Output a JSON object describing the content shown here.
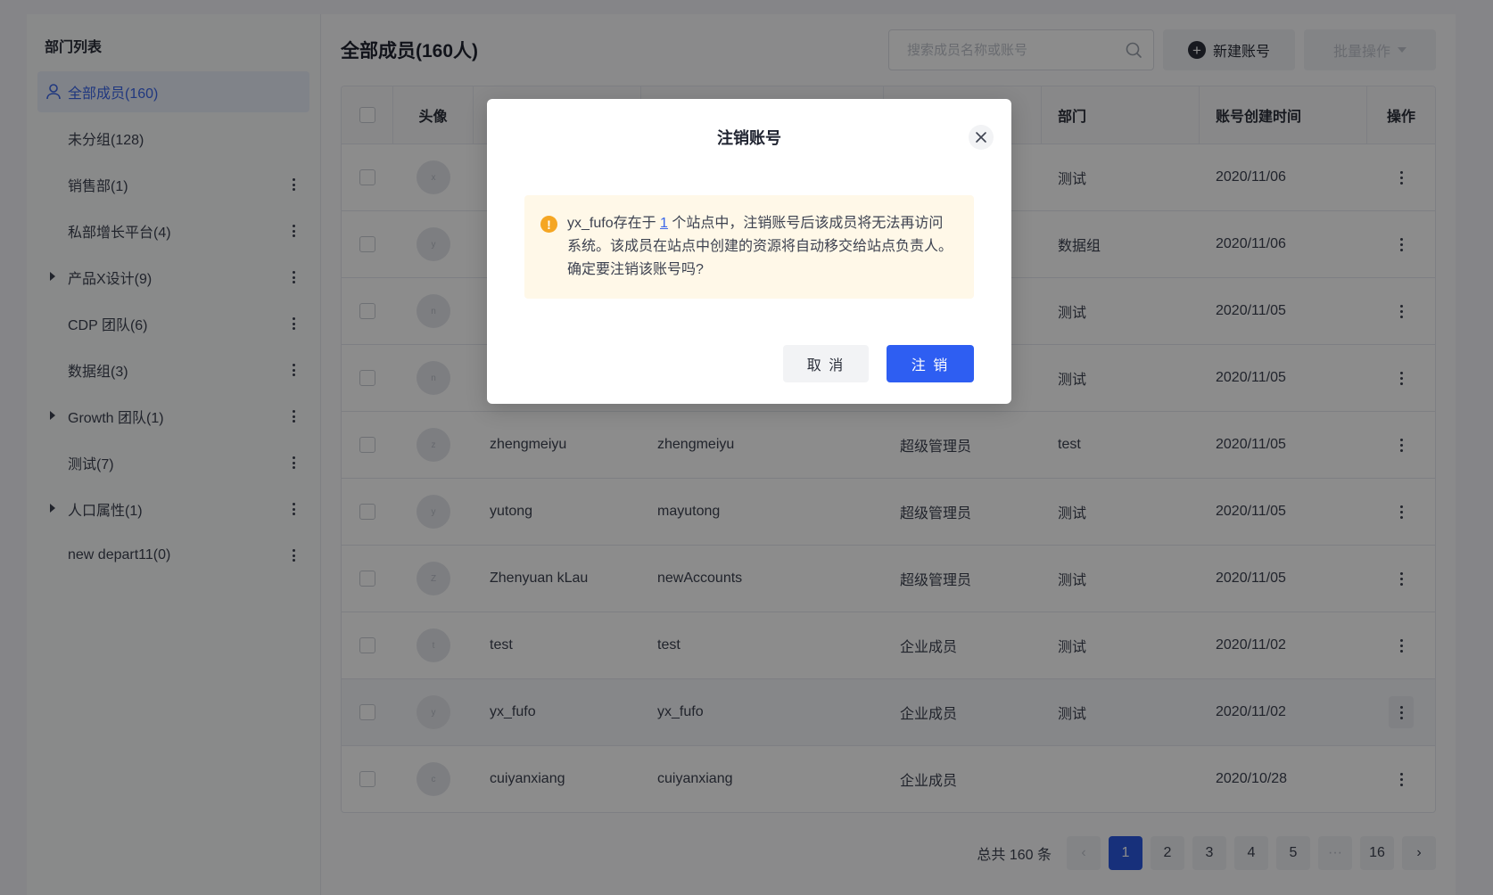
{
  "sidebar": {
    "title": "部门列表",
    "items": [
      {
        "label": "全部成员(160)"
      },
      {
        "label": "未分组(128)"
      },
      {
        "label": "销售部(1)"
      },
      {
        "label": "私部增长平台(4)"
      },
      {
        "label": "产品X设计(9)"
      },
      {
        "label": "CDP 团队(6)"
      },
      {
        "label": "数据组(3)"
      },
      {
        "label": "Growth 团队(1)"
      },
      {
        "label": "测试(7)"
      },
      {
        "label": "人口属性(1)"
      },
      {
        "label": "new depart11(0)"
      }
    ]
  },
  "header": {
    "title": "全部成员(160人)",
    "search_placeholder": "搜索成员名称或账号",
    "new_button": "新建账号",
    "batch_button": "批量操作"
  },
  "table": {
    "columns": {
      "avatar": "头像",
      "dept": "部门",
      "time": "账号创建时间",
      "op": "操作"
    },
    "rows": [
      {
        "avatar": "x",
        "name": "",
        "account": "",
        "role": "",
        "dept": "测试",
        "time": "2020/11/06"
      },
      {
        "avatar": "y",
        "name": "",
        "account": "",
        "role": "",
        "dept": "数据组",
        "time": "2020/11/06"
      },
      {
        "avatar": "n",
        "name": "",
        "account": "",
        "role": "",
        "dept": "测试",
        "time": "2020/11/05"
      },
      {
        "avatar": "n",
        "name": "",
        "account": "",
        "role": "",
        "dept": "测试",
        "time": "2020/11/05"
      },
      {
        "avatar": "z",
        "name": "zhengmeiyu",
        "account": "zhengmeiyu",
        "role": "超级管理员",
        "dept": "test",
        "time": "2020/11/05"
      },
      {
        "avatar": "y",
        "name": "yutong",
        "account": "mayutong",
        "role": "超级管理员",
        "dept": "测试",
        "time": "2020/11/05"
      },
      {
        "avatar": "Z",
        "name": "Zhenyuan kLau",
        "account": "newAccounts",
        "role": "超级管理员",
        "dept": "测试",
        "time": "2020/11/05"
      },
      {
        "avatar": "t",
        "name": "test",
        "account": "test",
        "role": "企业成员",
        "dept": "测试",
        "time": "2020/11/02"
      },
      {
        "avatar": "y",
        "name": "yx_fufo",
        "account": "yx_fufo",
        "role": "企业成员",
        "dept": "测试",
        "time": "2020/11/02"
      },
      {
        "avatar": "c",
        "name": "cuiyanxiang",
        "account": "cuiyanxiang",
        "role": "企业成员",
        "dept": "",
        "time": "2020/10/28"
      }
    ]
  },
  "pagination": {
    "total": "总共 160 条",
    "prev": "‹",
    "pages": [
      "1",
      "2",
      "3",
      "4",
      "5"
    ],
    "ellipsis": "···",
    "last": "16",
    "next": "›"
  },
  "modal": {
    "title": "注销账号",
    "message_before": "yx_fufo存在于 ",
    "message_link": "1",
    "message_after": " 个站点中，注销账号后该成员将无法再访问系统。该成员在站点中创建的资源将自动移交给站点负责人。确定要注销该账号吗?",
    "cancel": "取 消",
    "confirm": "注 销"
  },
  "colors": {
    "primary": "#2e5ef2",
    "warning": "#f5a623",
    "alert_bg": "#fff8e8"
  }
}
